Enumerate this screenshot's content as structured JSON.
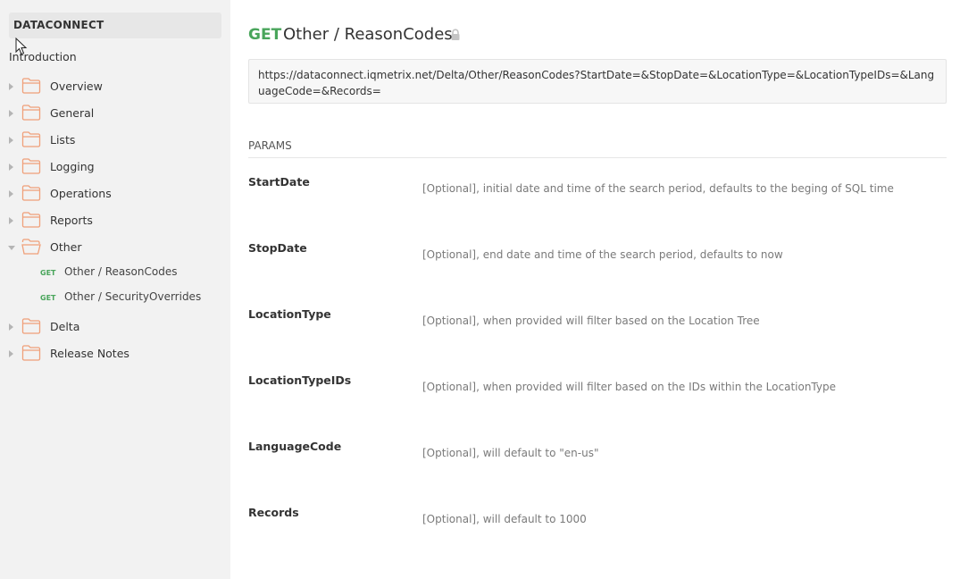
{
  "sidebar": {
    "brand": "DATACONNECT",
    "introduction": "Introduction",
    "folders": [
      {
        "label": "Overview",
        "expanded": false
      },
      {
        "label": "General",
        "expanded": false
      },
      {
        "label": "Lists",
        "expanded": false
      },
      {
        "label": "Logging",
        "expanded": false
      },
      {
        "label": "Operations",
        "expanded": false
      },
      {
        "label": "Reports",
        "expanded": false
      },
      {
        "label": "Other",
        "expanded": true
      },
      {
        "label": "Delta",
        "expanded": false
      },
      {
        "label": "Release Notes",
        "expanded": false
      }
    ],
    "other_endpoints": [
      {
        "method": "GET",
        "label": "Other / ReasonCodes"
      },
      {
        "method": "GET",
        "label": "Other / SecurityOverrides"
      }
    ]
  },
  "request": {
    "method": "GET",
    "title": "Other / ReasonCodes",
    "url": "https://dataconnect.iqmetrix.net/Delta/Other/ReasonCodes?StartDate=&StopDate=&LocationType=&LocationTypeIDs=&LanguageCode=&Records="
  },
  "params": {
    "heading": "PARAMS",
    "items": [
      {
        "name": "StartDate",
        "description": "[Optional], initial date and time of the search period, defaults to the beging of SQL time"
      },
      {
        "name": "StopDate",
        "description": "[Optional], end date and time of the search period, defaults to now"
      },
      {
        "name": "LocationType",
        "description": "[Optional], when provided will filter based on the Location Tree"
      },
      {
        "name": "LocationTypeIDs",
        "description": "[Optional], when provided will filter based on the IDs within the LocationType"
      },
      {
        "name": "LanguageCode",
        "description": "[Optional], will default to \"en-us\""
      },
      {
        "name": "Records",
        "description": "[Optional], will default to 1000"
      }
    ]
  },
  "colors": {
    "method_green": "#49a55b",
    "folder_orange": "#f0a07a",
    "sidebar_bg": "#f2f2f2"
  }
}
